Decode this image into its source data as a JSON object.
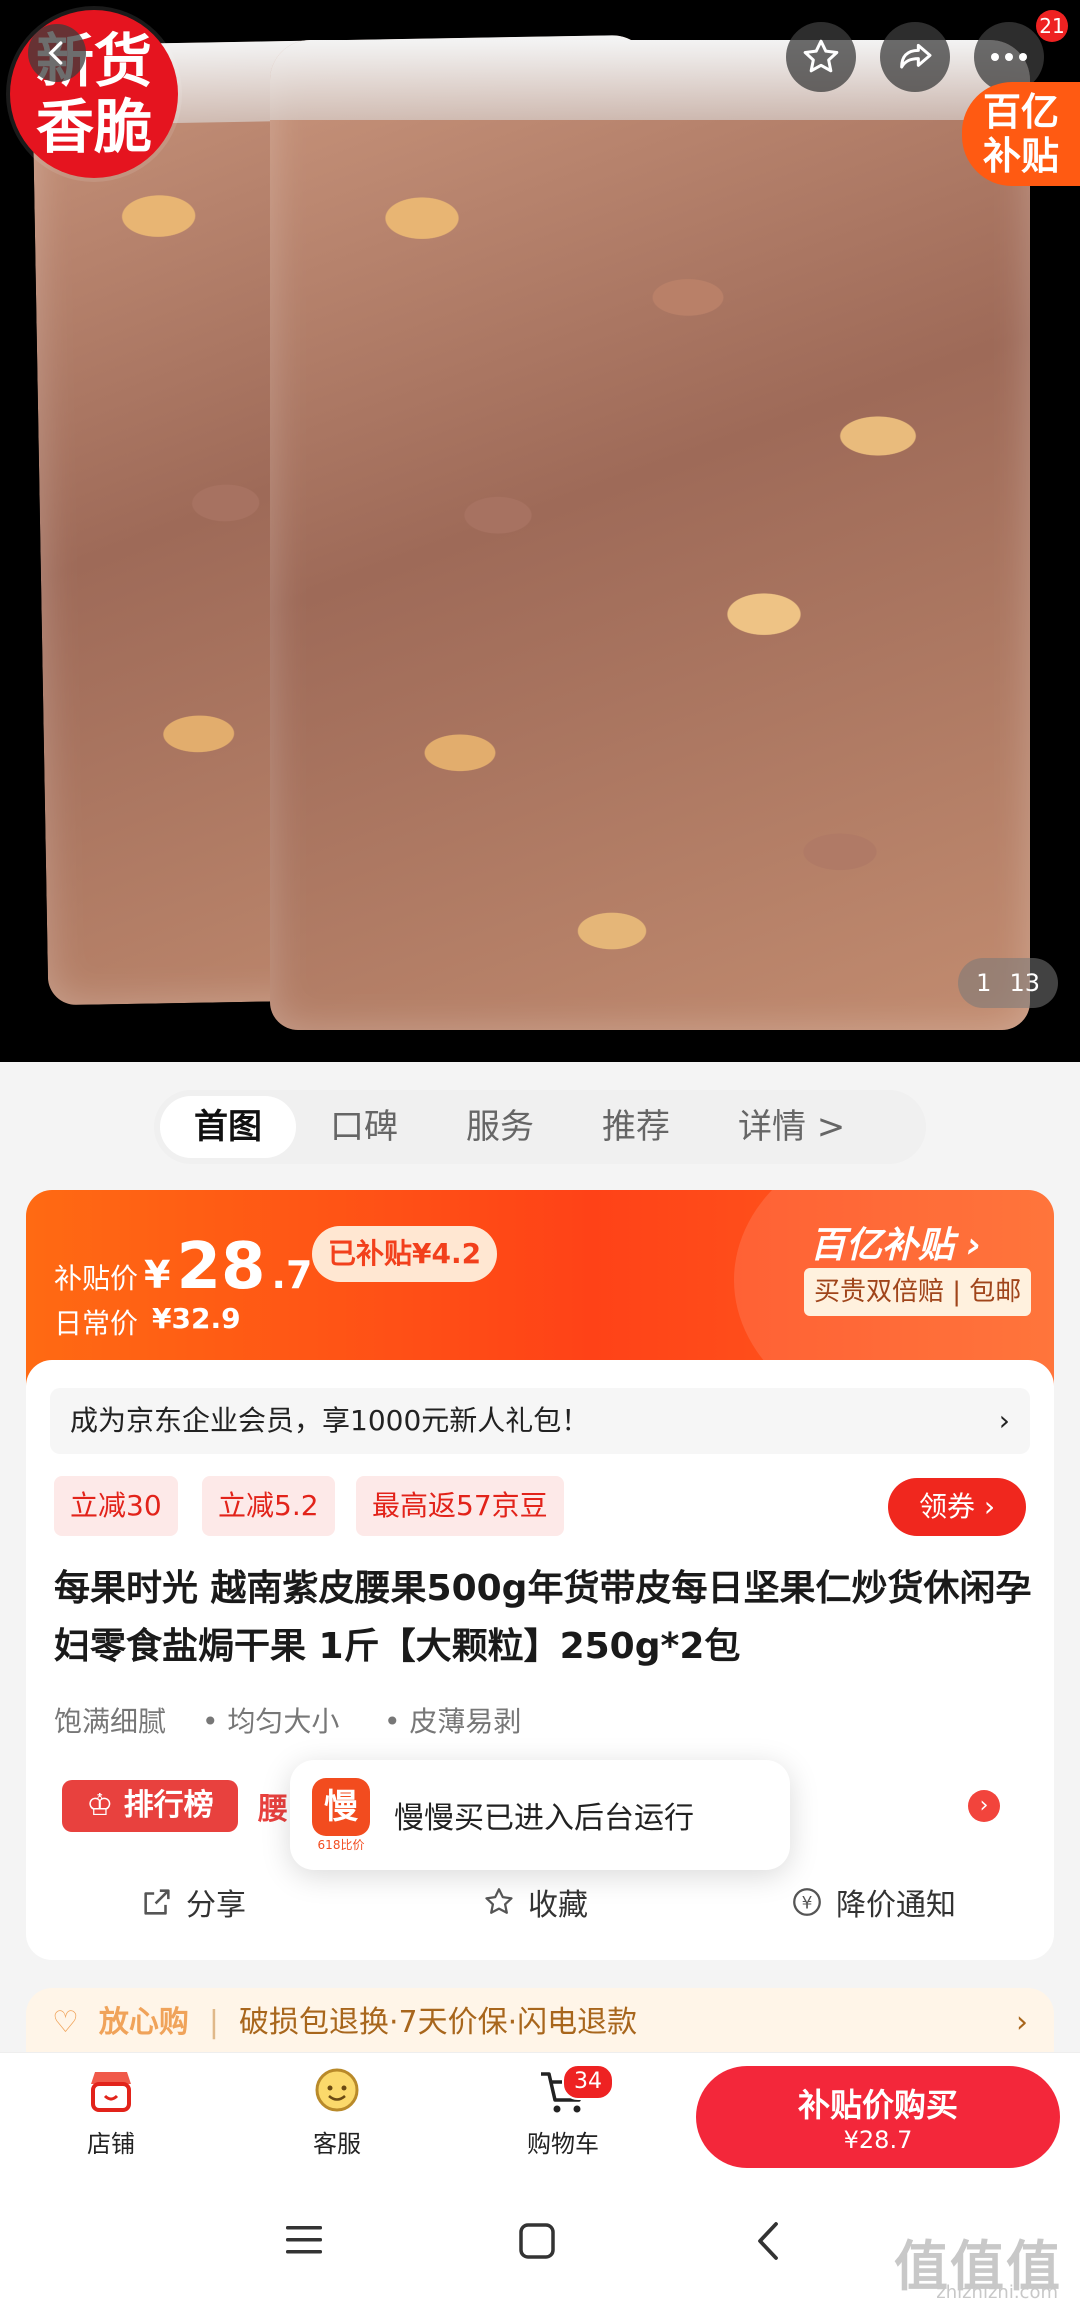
{
  "hero": {
    "badge_new_line1": "新货",
    "badge_new_line2": "香脆",
    "subsidy_badge_line1": "百亿",
    "subsidy_badge_line2": "补贴",
    "notif_count": "21",
    "pager_current": "1",
    "pager_total": "13"
  },
  "tabs": [
    "首图",
    "口碑",
    "服务",
    "推荐",
    "详情 >"
  ],
  "price": {
    "sub_label": "补贴价",
    "currency": "¥",
    "main": "28",
    "decimal": ".7",
    "subsidy_tag": "已补贴¥4.2",
    "daily_label": "日常价",
    "daily_price": "¥32.9",
    "brand": "百亿补贴 ›",
    "guarantee": "买贵双倍赔 | 包邮"
  },
  "member_banner": {
    "text": "成为京东企业会员，享1000元新人礼包！",
    "arrow": "›"
  },
  "promos": [
    "立减30",
    "立减5.2",
    "最高返57京豆"
  ],
  "coupon_label": "领券 ›",
  "product_title": "每果时光 越南紫皮腰果500g年货带皮每日坚果仁炒货休闲孕妇零食盐焗干果 1斤【大颗粒】250g*2包",
  "features": [
    "饱满细腻",
    "• 均匀大小",
    "• 皮薄易剥"
  ],
  "rank": {
    "label": "排行榜",
    "text_fragment": "腰"
  },
  "toast": {
    "icon_text": "慢",
    "icon_sub": "618比价",
    "message": "慢慢买已进入后台运行"
  },
  "actions": {
    "share": "分享",
    "favorite": "收藏",
    "price_alert": "降价通知"
  },
  "assurance": {
    "label": "放心购",
    "text": "破损包退换·7天价保·闪电退款",
    "arrow": "›"
  },
  "bottom": {
    "shop": "店铺",
    "service": "客服",
    "cart": "购物车",
    "cart_count": "34",
    "buy_label": "补贴价购买",
    "buy_price": "¥28.7"
  },
  "watermark": {
    "main": "值值值",
    "sub": "zhizhizhi.com"
  },
  "colors": {
    "accent": "#ff4217",
    "buy": "#f3273a",
    "promo_text": "#e2231a"
  }
}
